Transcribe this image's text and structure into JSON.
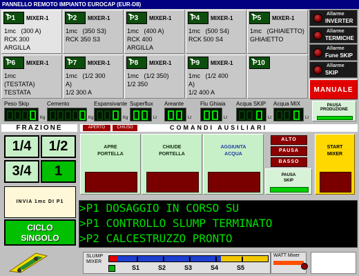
{
  "window": {
    "title": "PANNELLO REMOTO  IMPIANTO EUROCAP (EUR-D8)"
  },
  "mixers": [
    {
      "tag": "P1",
      "name": "MIXER-1",
      "line1a": "1mc",
      "line1b": "(300 A)",
      "line2": "RCK 300",
      "line3": "ARGILLA"
    },
    {
      "tag": "P2",
      "name": "MIXER-1",
      "line1a": "1mc",
      "line1b": "(350 S3)",
      "line2": "RCK 350 S3",
      "line3": ""
    },
    {
      "tag": "P3",
      "name": "MIXER-1",
      "line1a": "1mc",
      "line1b": "(400 A)",
      "line2": "RCK 400",
      "line3": "ARGILLA"
    },
    {
      "tag": "P4",
      "name": "MIXER-1",
      "line1a": "1mc",
      "line1b": "(500 S4)",
      "line2": "RCK 500 S4",
      "line3": ""
    },
    {
      "tag": "P5",
      "name": "MIXER-1",
      "line1a": "1mc",
      "line1b": "(GHIAIETTO)",
      "line2": "GHIAIETTO",
      "line3": ""
    },
    {
      "tag": "P6",
      "name": "MIXER-1",
      "line1a": "1mc",
      "line1b": "",
      "line2": "(TESTATA)",
      "line3": "TESTATA"
    },
    {
      "tag": "P7",
      "name": "MIXER-1",
      "line1a": "1mc",
      "line1b": "(1/2 300",
      "line2": "A)",
      "line3": "1/2 300 A"
    },
    {
      "tag": "P8",
      "name": "MIXER-1",
      "line1a": "1mc",
      "line1b": "(1/2 350)",
      "line2": "1/2 350",
      "line3": ""
    },
    {
      "tag": "P9",
      "name": "MIXER-1",
      "line1a": "1mc",
      "line1b": "(1/2 400",
      "line2": "A)",
      "line3": "1/2 400 A"
    },
    {
      "tag": "P10",
      "name": "",
      "line1a": "",
      "line1b": "",
      "line2": "",
      "line3": ""
    }
  ],
  "alarms": [
    {
      "top": "Allarme",
      "label": "INVERTER"
    },
    {
      "top": "Allarme",
      "label": "TERMICHE"
    },
    {
      "top": "Allarme",
      "label": "Fune SKIP"
    },
    {
      "top": "Allarme",
      "label": "SKIP"
    }
  ],
  "manuale_label": "MANUALE",
  "gauges": [
    {
      "label": "Peso Skip",
      "unit": "Kg"
    },
    {
      "label": "Cemento",
      "unit": "Kg"
    },
    {
      "label": "Espansivante",
      "unit": "Kg"
    },
    {
      "label": "Superflux",
      "unit": "Lt"
    },
    {
      "label": "Areante",
      "unit": "Lt"
    },
    {
      "label": "Flu Ghiaia",
      "unit": "Lt"
    },
    {
      "label": "Acqua SKIP",
      "unit": "Lt"
    },
    {
      "label": "Acqua MIX",
      "unit": "Lt"
    }
  ],
  "pausa_produzione": {
    "line1": "PAUSA",
    "line2": "PRODUZIONE"
  },
  "frazione": {
    "header": "FRAZIONE",
    "buttons": [
      "1/4",
      "1/2",
      "3/4",
      "1"
    ],
    "selected": "1",
    "invia_label": "INVIA 1mc DI P1",
    "ciclo_line1": "CICLO",
    "ciclo_line2": "SINGOLO"
  },
  "comandi": {
    "header": "COMANDI   AUSILIARI",
    "tag_aperto": "APERTO",
    "tag_chiuso": "CHIUSO",
    "apre_portella": [
      "APRE",
      "PORTELLA"
    ],
    "chiude_portella": [
      "CHIUDE",
      "PORTELLA"
    ],
    "aggiunta_acqua": [
      "AGGIUNTA",
      "ACQUA"
    ],
    "alto": "ALTO",
    "pausa": "PAUSA",
    "basso": "BASSO",
    "pausa_skip": [
      "PAUSA",
      "SKIP"
    ],
    "start_mixer": [
      "START",
      "MIXER"
    ]
  },
  "messages": [
    ">P1 DOSAGGIO IN CORSO SU",
    ">P1 CONTROLLO SLUMP TERMINATO",
    ">P2 CALCESTRUZZO PRONTO"
  ],
  "slump": {
    "label_line1": "SLUMP",
    "label_line2": "MIXER",
    "steps": [
      "S1",
      "S2",
      "S3",
      "S4",
      "S5"
    ],
    "level_fraction": 0.05
  },
  "watt": {
    "label": "WATT Mixer"
  }
}
